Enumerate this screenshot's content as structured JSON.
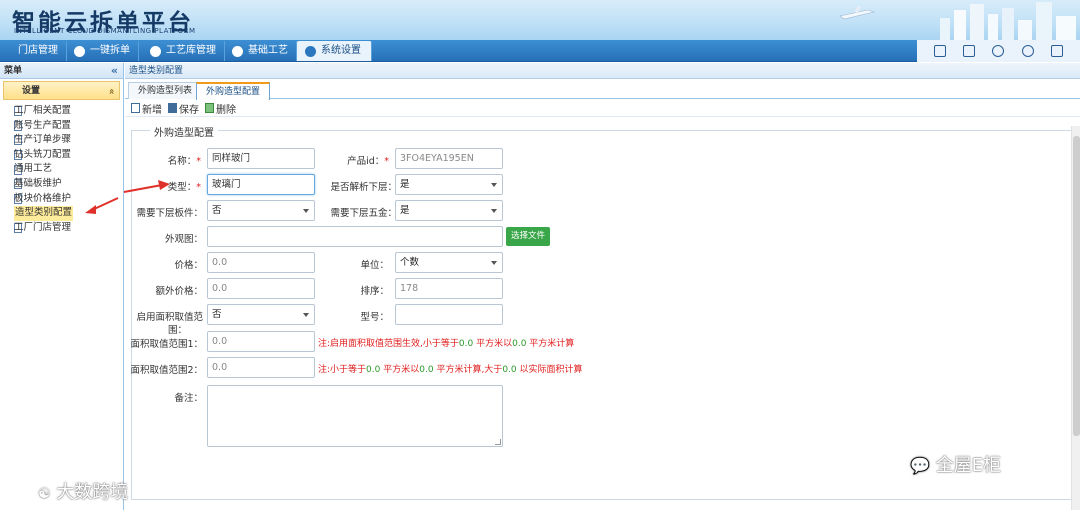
{
  "header": {
    "title": "智能云拆单平台",
    "subtitle": "INTELLIGENT CLOUD DISMANTLING PLATFORM"
  },
  "nav": {
    "tabs": [
      {
        "label": "门店管理"
      },
      {
        "label": "一键拆单"
      },
      {
        "label": "工艺库管理"
      },
      {
        "label": "基础工艺"
      },
      {
        "label": "系统设置"
      }
    ],
    "active": "系统设置",
    "tool_icons": [
      "monitor-icon",
      "calendar-icon",
      "user-icon",
      "gear-icon",
      "logout-icon"
    ]
  },
  "sidebar": {
    "header": "菜单",
    "collapse_glyph": "«",
    "group": "设置",
    "group_glyph": "»",
    "items": [
      {
        "label": "工厂相关配置"
      },
      {
        "label": "账号生产配置"
      },
      {
        "label": "生产订单步骤"
      },
      {
        "label": "钻头铣刀配置"
      },
      {
        "label": "通用工艺"
      },
      {
        "label": "基础板维护"
      },
      {
        "label": "板块价格维护"
      },
      {
        "label": "造型类别配置"
      },
      {
        "label": "工厂门店管理"
      }
    ],
    "active_item": "造型类别配置"
  },
  "main": {
    "breadcrumb": "造型类别配置",
    "tabs": [
      {
        "label": "外购造型列表"
      },
      {
        "label": "外购造型配置"
      }
    ],
    "active_tab": "外购造型配置",
    "toolbar": {
      "new_label": "新增",
      "save_label": "保存",
      "delete_label": "删除"
    },
    "section_title": "外购造型配置",
    "form": {
      "name_label": "名称：",
      "name_value": "同样玻门",
      "product_id_label": "产品id：",
      "product_id_value": "3FO4EYA195EN",
      "type_label": "类型：",
      "type_value": "玻璃门",
      "parse_lower_label": "是否解析下层：",
      "parse_lower_value": "是",
      "need_lower_board_label": "需要下层板件：",
      "need_lower_board_value": "否",
      "need_lower_hardware_label": "需要下层五金：",
      "need_lower_hardware_value": "是",
      "appearance_label": "外观图：",
      "appearance_value": "",
      "choose_file_label": "选择文件",
      "price_label": "价格：",
      "price_value": "0.0",
      "unit_label": "单位：",
      "unit_value": "个数",
      "extra_price_label": "额外价格：",
      "extra_price_value": "0.0",
      "sort_label": "排序：",
      "sort_value": "178",
      "enable_area_label_1": "启用面积取值范",
      "enable_area_label_2": "围：",
      "enable_area_value": "否",
      "model_label": "型号：",
      "model_value": "",
      "area_range1_label": "面积取值范围1：",
      "area_range1_value": "0.0",
      "area_range1_note": {
        "a": "注:启用面积取值范围生效,小于等于",
        "b": "0.0",
        "c": " 平方米以",
        "d": "0.0",
        "e": " 平方米计算"
      },
      "area_range2_label": "面积取值范围2：",
      "area_range2_value": "0.0",
      "area_range2_note": {
        "a": "注:小于等于",
        "b": "0.0",
        "c": " 平方米以",
        "d": "0.0",
        "e": " 平方米计算,大于",
        "f": "0.0",
        "g": " 以实际面积计算"
      },
      "remark_label": "备注：",
      "remark_value": ""
    }
  },
  "watermarks": {
    "left": "大数跨境",
    "right": "全屋E柜"
  },
  "colors": {
    "nav_blue": "#2670b8",
    "required_red": "#e02020",
    "note_green": "#2a9a2a",
    "button_green": "#3aa64a",
    "active_tab_orange": "#f29a1b",
    "annotation_red": "#e0302a"
  }
}
